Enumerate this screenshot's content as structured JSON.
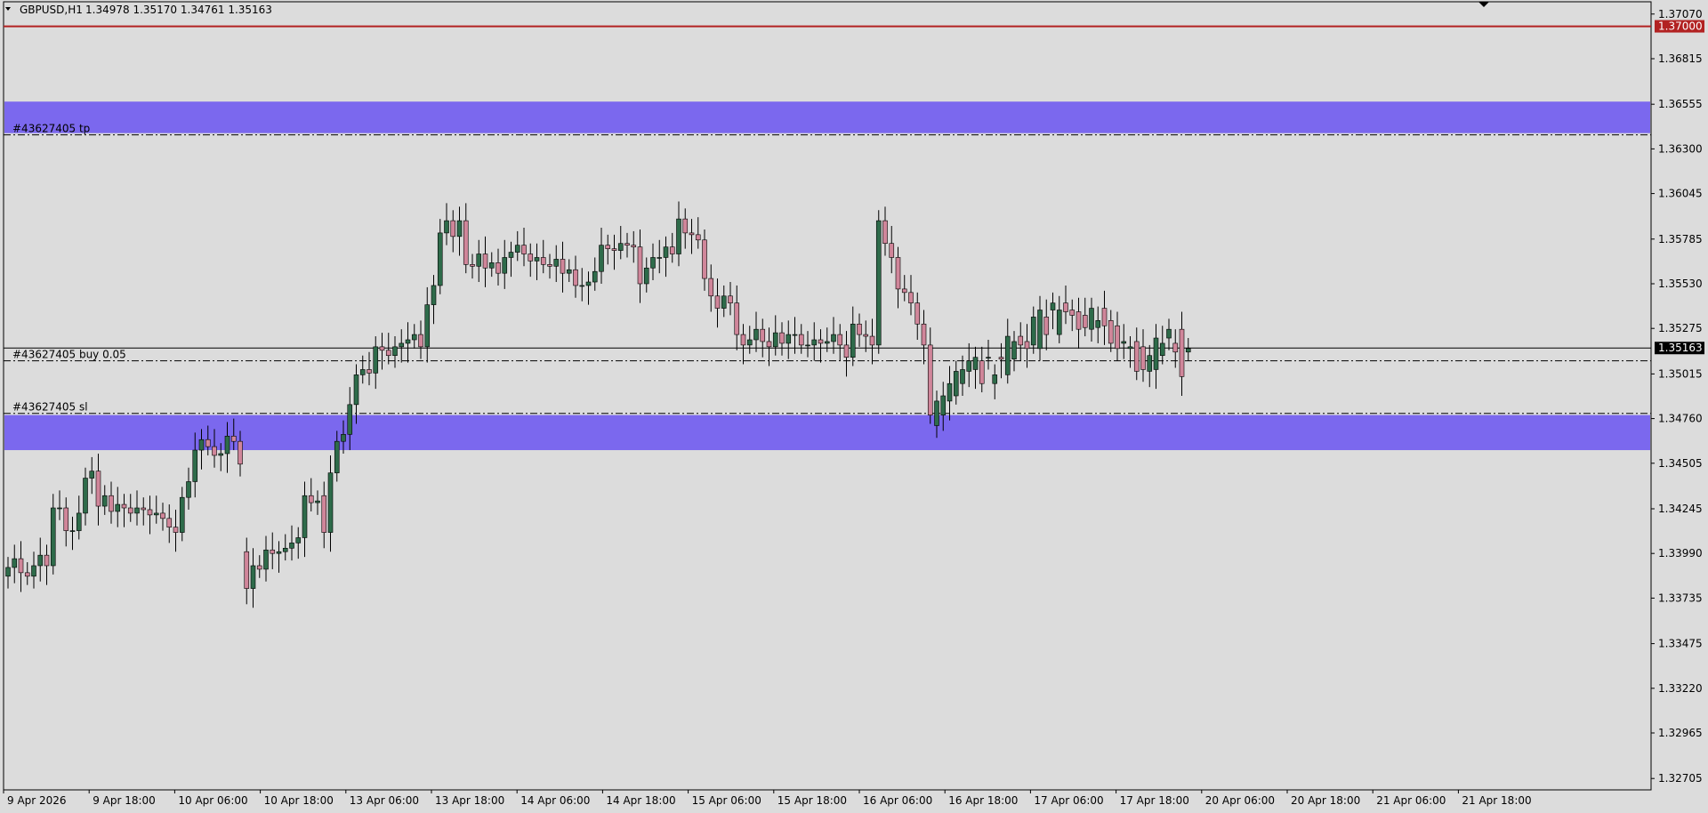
{
  "header": {
    "symbol": "GBPUSD,H1",
    "ohlc": "1.34978 1.35170 1.34761 1.35163"
  },
  "colors": {
    "background": "#dcdcdc",
    "bull": "#2e6b4a",
    "bear": "#d0869a",
    "zone": "#7b68ee",
    "resistance": "#b22222",
    "axis_frame": "#000000"
  },
  "levels": {
    "resistance_label": "1.37000",
    "current_price_label": "1.35163",
    "tp_label": "#43627405 tp",
    "entry_label": "#43627405 buy 0.05",
    "sl_label": "#43627405 sl"
  },
  "chart_data": {
    "type": "candlestick",
    "title": "GBPUSD,H1",
    "price_ticks": [
      "1.37070",
      "1.36815",
      "1.36555",
      "1.36300",
      "1.36045",
      "1.35785",
      "1.35530",
      "1.35275",
      "1.35015",
      "1.34760",
      "1.34505",
      "1.34245",
      "1.33990",
      "1.33735",
      "1.33475",
      "1.33220",
      "1.32965",
      "1.32705"
    ],
    "time_ticks": [
      "9 Apr 2026",
      "9 Apr 18:00",
      "10 Apr 06:00",
      "10 Apr 18:00",
      "13 Apr 06:00",
      "13 Apr 18:00",
      "14 Apr 06:00",
      "14 Apr 18:00",
      "15 Apr 06:00",
      "15 Apr 18:00",
      "16 Apr 06:00",
      "16 Apr 18:00",
      "17 Apr 06:00",
      "17 Apr 18:00",
      "20 Apr 06:00",
      "20 Apr 18:00",
      "21 Apr 06:00",
      "21 Apr 18:00"
    ],
    "ylim": [
      1.3264,
      1.3714
    ],
    "horizontal_levels": {
      "resistance": 1.37,
      "tp": 1.3638,
      "entry": 1.3509,
      "sl": 1.3479,
      "current": 1.35163,
      "tp_zone": [
        1.3639,
        1.3657
      ],
      "sl_zone": [
        1.3458,
        1.3478
      ]
    },
    "series": [
      {
        "closes": [
          1.3391,
          1.3396,
          1.3388,
          1.3386,
          1.3392,
          1.3398,
          1.3392,
          1.3425,
          1.3425,
          1.3412,
          1.3412,
          1.3422,
          1.3442,
          1.3446,
          1.3426,
          1.3432,
          1.3423,
          1.3427,
          1.3425,
          1.3422,
          1.3425,
          1.3424,
          1.3421,
          1.3422,
          1.3419,
          1.3414,
          1.3411,
          1.3431,
          1.344,
          1.3458,
          1.3464,
          1.346,
          1.3455,
          1.3456,
          1.3466,
          1.3463,
          1.345,
          1.3379,
          1.3392,
          1.339,
          1.3401,
          1.3399,
          1.34,
          1.3402,
          1.3405,
          1.3408,
          1.3432,
          1.3428,
          1.3429,
          1.3411,
          1.3445,
          1.3463,
          1.3467,
          1.3484,
          1.3501,
          1.3504,
          1.3502,
          1.3517,
          1.3515,
          1.3512,
          1.3517,
          1.3519,
          1.3521,
          1.3524,
          1.3517,
          1.3541,
          1.3552,
          1.3582,
          1.3589,
          1.358,
          1.3589,
          1.3564,
          1.3563,
          1.357,
          1.3562,
          1.3565,
          1.3559,
          1.3568,
          1.3571,
          1.3575,
          1.357,
          1.3566,
          1.3568,
          1.3564,
          1.3563,
          1.3567,
          1.3559,
          1.3561,
          1.3552,
          1.3552,
          1.3554,
          1.356,
          1.3575,
          1.3573,
          1.3572,
          1.3576,
          1.3575,
          1.3574,
          1.3553,
          1.3562,
          1.3568,
          1.3568,
          1.3574,
          1.357,
          1.359,
          1.3582,
          1.3581,
          1.3578,
          1.3556,
          1.3546,
          1.3539,
          1.3546,
          1.3542,
          1.3524,
          1.3518,
          1.3521,
          1.3527,
          1.352,
          1.3517,
          1.3525,
          1.3519,
          1.3524,
          1.3524,
          1.3518,
          1.3518,
          1.3521,
          1.3519,
          1.352,
          1.3524,
          1.3518,
          1.3511,
          1.353,
          1.3524,
          1.3523,
          1.3518,
          1.3589,
          1.3576,
          1.3568,
          1.355,
          1.3548,
          1.3542,
          1.353,
          1.3518,
          1.3478,
          1.3486,
          1.3489,
          1.3496,
          1.3503,
          1.3504,
          1.3509,
          1.3511,
          1.3496,
          1.3511,
          1.3501,
          1.351,
          1.3523,
          1.352,
          1.3518,
          1.3516,
          1.3534,
          1.3538,
          1.3524,
          1.3542,
          1.3538,
          1.3537,
          1.3535,
          1.3527,
          1.3528,
          1.3539,
          1.3532,
          1.3529,
          1.3519,
          1.3516,
          1.352,
          1.3517,
          1.3503,
          1.3504,
          1.3512,
          1.3522,
          1.3519,
          1.3527,
          1.3514,
          1.35,
          1.3516
        ],
        "opens": [
          1.3386,
          1.3391,
          1.3396,
          1.3388,
          1.3386,
          1.3392,
          1.3398,
          1.3392,
          1.3425,
          1.3425,
          1.3412,
          1.3412,
          1.3422,
          1.3442,
          1.3446,
          1.3426,
          1.3432,
          1.3423,
          1.3427,
          1.3425,
          1.3422,
          1.3425,
          1.3424,
          1.3421,
          1.3422,
          1.3419,
          1.3414,
          1.3411,
          1.3431,
          1.344,
          1.3458,
          1.3464,
          1.346,
          1.3455,
          1.3456,
          1.3466,
          1.3463,
          1.34,
          1.3379,
          1.3392,
          1.339,
          1.3401,
          1.3399,
          1.34,
          1.3402,
          1.3405,
          1.3408,
          1.3432,
          1.3428,
          1.3432,
          1.3411,
          1.3445,
          1.3463,
          1.3467,
          1.3484,
          1.3501,
          1.3504,
          1.3502,
          1.3517,
          1.3515,
          1.3512,
          1.3517,
          1.3519,
          1.3521,
          1.3524,
          1.3517,
          1.3541,
          1.3552,
          1.3582,
          1.3589,
          1.358,
          1.3589,
          1.3564,
          1.3563,
          1.357,
          1.3562,
          1.3565,
          1.3559,
          1.3568,
          1.3571,
          1.3575,
          1.357,
          1.3566,
          1.3568,
          1.3564,
          1.3563,
          1.3567,
          1.3559,
          1.3561,
          1.3552,
          1.3552,
          1.3554,
          1.356,
          1.3575,
          1.3573,
          1.3572,
          1.3576,
          1.3575,
          1.3574,
          1.3553,
          1.3562,
          1.3568,
          1.3568,
          1.3574,
          1.357,
          1.359,
          1.3582,
          1.3581,
          1.3578,
          1.3556,
          1.3546,
          1.3539,
          1.3546,
          1.3542,
          1.3524,
          1.3518,
          1.3521,
          1.3527,
          1.352,
          1.3517,
          1.3525,
          1.3519,
          1.3524,
          1.3524,
          1.3518,
          1.3518,
          1.3521,
          1.3519,
          1.352,
          1.3524,
          1.3518,
          1.3511,
          1.353,
          1.3524,
          1.3523,
          1.3518,
          1.3589,
          1.3576,
          1.3568,
          1.355,
          1.3548,
          1.3542,
          1.353,
          1.3518,
          1.3472,
          1.3478,
          1.3486,
          1.3489,
          1.3496,
          1.3503,
          1.3504,
          1.3509,
          1.3511,
          1.3496,
          1.3511,
          1.3501,
          1.351,
          1.3523,
          1.352,
          1.3518,
          1.3516,
          1.3534,
          1.3538,
          1.3524,
          1.3542,
          1.3538,
          1.3537,
          1.3535,
          1.3527,
          1.3528,
          1.3539,
          1.3532,
          1.3529,
          1.3519,
          1.3516,
          1.352,
          1.3517,
          1.3503,
          1.3504,
          1.3512,
          1.3522,
          1.3519,
          1.3527,
          1.3514,
          1.3498
        ]
      }
    ]
  }
}
